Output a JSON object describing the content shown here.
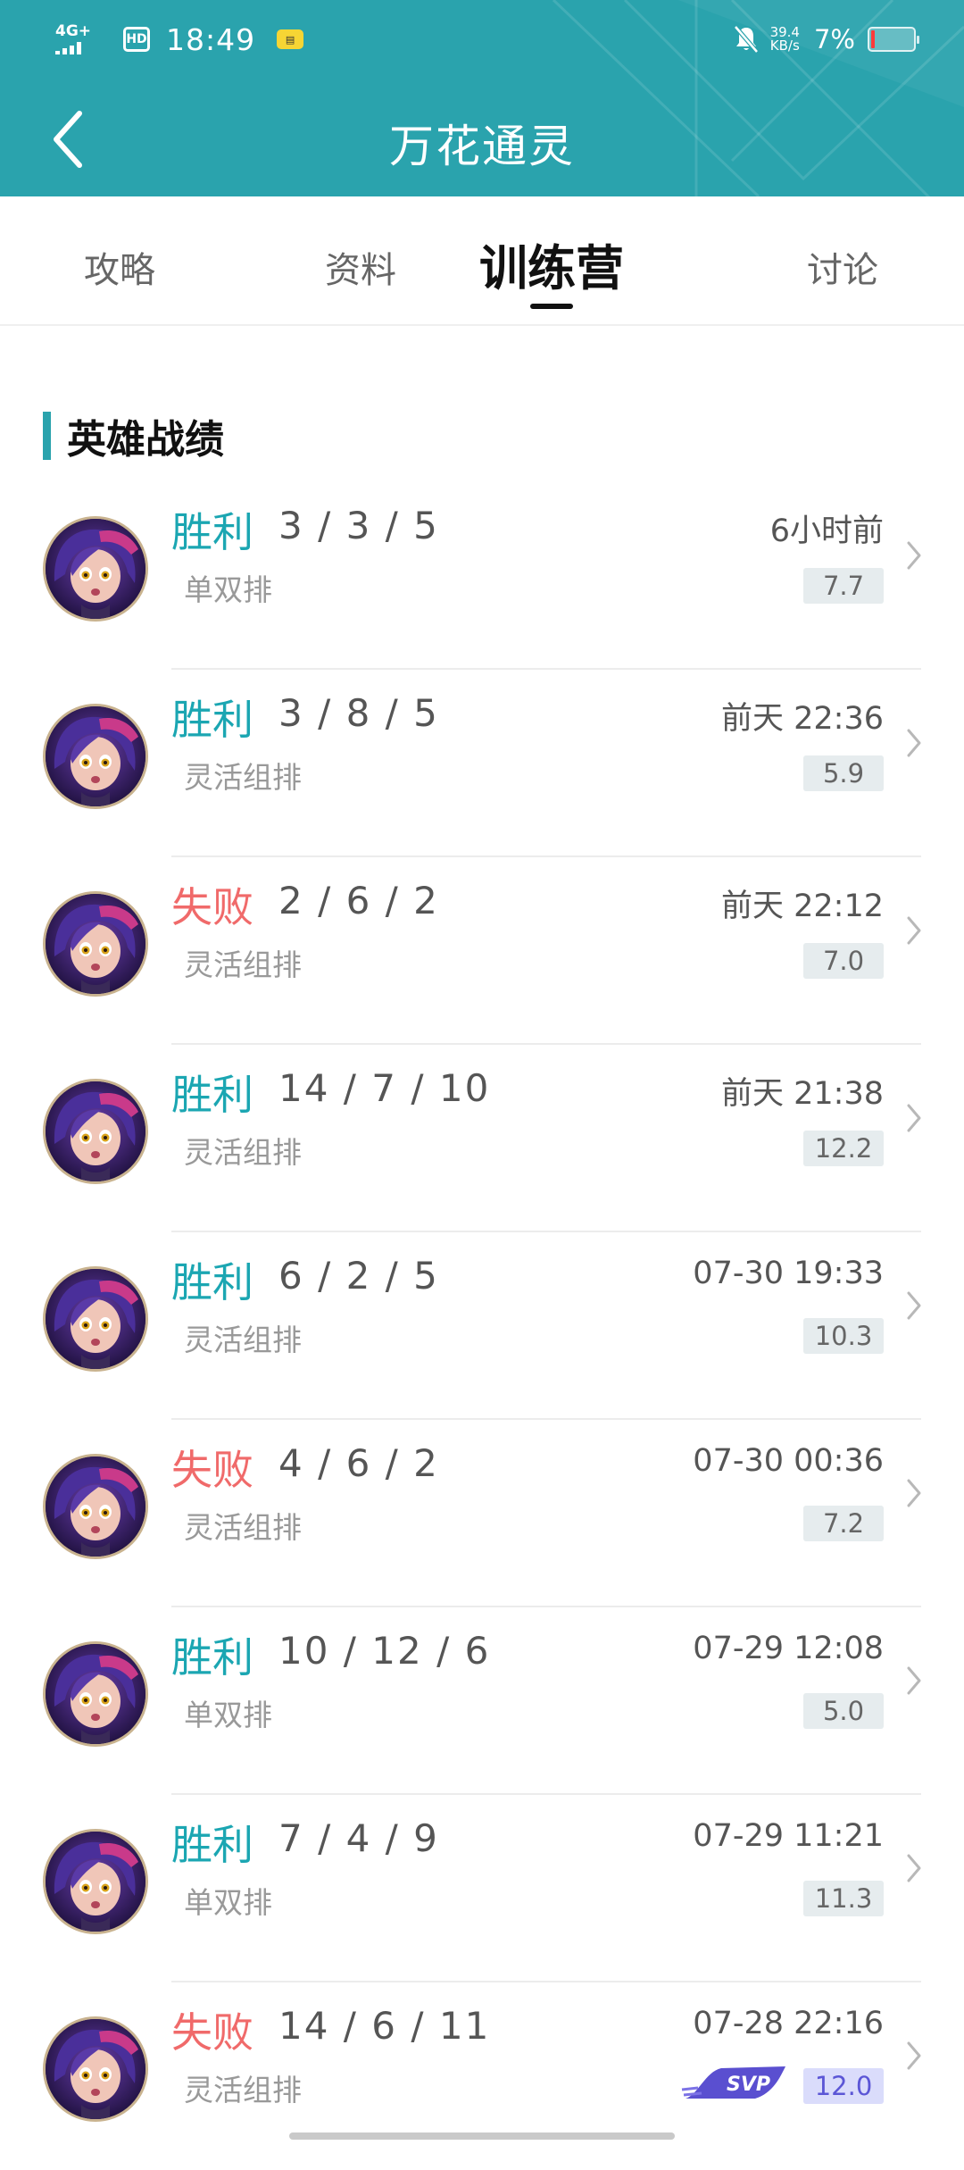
{
  "status_bar": {
    "network": "4G+",
    "hd": "HD",
    "time": "18:49",
    "notification_icon": "app-notification-icon",
    "speed_value": "39.4",
    "speed_unit": "KB/s",
    "battery_percent": "7%",
    "battery_level": 0.07
  },
  "header": {
    "title": "万花通灵",
    "back_icon": "chevron-left-icon"
  },
  "tabs": [
    {
      "label": "攻略",
      "active": false
    },
    {
      "label": "资料",
      "active": false
    },
    {
      "label": "训练营",
      "active": true
    },
    {
      "label": "讨论",
      "active": false
    }
  ],
  "section": {
    "title": "英雄战绩"
  },
  "colors": {
    "header_bg": "#2aa3ad",
    "win": "#1ba6b2",
    "loss": "#f06a6a",
    "svp_score_bg": "#dadcfb",
    "svp_score_text": "#5b56d6"
  },
  "matches": [
    {
      "result": "胜利",
      "outcome": "win",
      "kda": "3 / 3 / 5",
      "mode": "单双排",
      "time": "6小时前",
      "score": "7.7",
      "svp": false
    },
    {
      "result": "胜利",
      "outcome": "win",
      "kda": "3 / 8 / 5",
      "mode": "灵活组排",
      "time": "前天 22:36",
      "score": "5.9",
      "svp": false
    },
    {
      "result": "失败",
      "outcome": "loss",
      "kda": "2 / 6 / 2",
      "mode": "灵活组排",
      "time": "前天 22:12",
      "score": "7.0",
      "svp": false
    },
    {
      "result": "胜利",
      "outcome": "win",
      "kda": "14 / 7 / 10",
      "mode": "灵活组排",
      "time": "前天 21:38",
      "score": "12.2",
      "svp": false
    },
    {
      "result": "胜利",
      "outcome": "win",
      "kda": "6 / 2 / 5",
      "mode": "灵活组排",
      "time": "07-30 19:33",
      "score": "10.3",
      "svp": false
    },
    {
      "result": "失败",
      "outcome": "loss",
      "kda": "4 / 6 / 2",
      "mode": "灵活组排",
      "time": "07-30 00:36",
      "score": "7.2",
      "svp": false
    },
    {
      "result": "胜利",
      "outcome": "win",
      "kda": "10 / 12 / 6",
      "mode": "单双排",
      "time": "07-29 12:08",
      "score": "5.0",
      "svp": false
    },
    {
      "result": "胜利",
      "outcome": "win",
      "kda": "7 / 4 / 9",
      "mode": "单双排",
      "time": "07-29 11:21",
      "score": "11.3",
      "svp": false
    },
    {
      "result": "失败",
      "outcome": "loss",
      "kda": "14 / 6 / 11",
      "mode": "灵活组排",
      "time": "07-28 22:16",
      "score": "12.0",
      "svp": true,
      "badge": "SVP"
    }
  ]
}
